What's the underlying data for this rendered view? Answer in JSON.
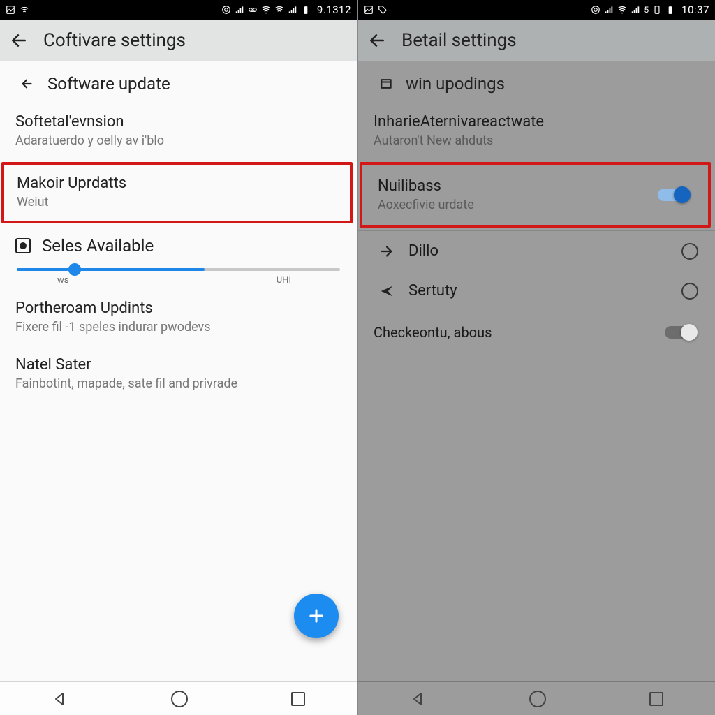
{
  "left": {
    "status": {
      "time": "9.1312"
    },
    "appbar": {
      "title": "Coftivare settings"
    },
    "subheader": {
      "title": "Software update"
    },
    "items": {
      "version": {
        "title": "Softetal'evnsion",
        "sub": "Adaratuerdo y oelly av i'blo"
      },
      "highlighted": {
        "title": "Makoir Uprdatts",
        "sub": "Weiut"
      },
      "slider": {
        "label": "Seles Available",
        "tick_low": "ws",
        "tick_high": "UHI",
        "percent": 18
      },
      "portheroam": {
        "title": "Portheroam Updints",
        "sub": "Fixere fil -1 speles indurar pwodevs"
      },
      "natel": {
        "title": "Natel Sater",
        "sub": "Fainbotint, mapade, sate fil and privrade"
      }
    }
  },
  "right": {
    "status": {
      "time": "10:37"
    },
    "appbar": {
      "title": "Betail settings"
    },
    "subheader": {
      "title": "win upodings"
    },
    "inharie": {
      "title": "InharieAternivareactwate",
      "sub": "Autaron't New ahduts"
    },
    "highlighted": {
      "title": "Nuilibass",
      "sub": "Aoxecfivie urdate",
      "toggle": true
    },
    "options": {
      "dillo": "Dillo",
      "sertuty": "Sertuty"
    },
    "check": {
      "label": "Checkeontu, abous",
      "toggle": false
    }
  }
}
